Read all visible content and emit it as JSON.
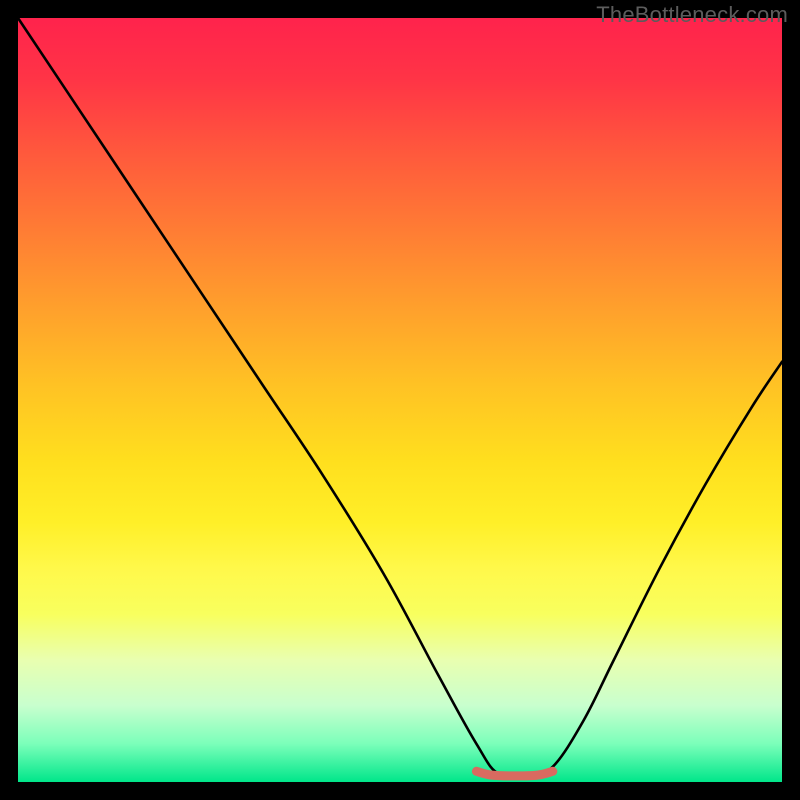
{
  "watermark": "TheBottleneck.com",
  "chart_data": {
    "type": "line",
    "title": "",
    "xlabel": "",
    "ylabel": "",
    "xlim": [
      0,
      100
    ],
    "ylim": [
      0,
      100
    ],
    "background_gradient": {
      "top_color": "#ff234c",
      "bottom_color": "#00e68a",
      "description": "vertical red-to-green heat gradient"
    },
    "series": [
      {
        "name": "bottleneck-curve",
        "color": "#000000",
        "x": [
          0,
          8,
          16,
          24,
          32,
          40,
          48,
          55,
          60,
          63,
          67,
          70,
          74,
          78,
          84,
          90,
          96,
          100
        ],
        "values": [
          100,
          88,
          76,
          64,
          52,
          40,
          27,
          14,
          5,
          1,
          1,
          2,
          8,
          16,
          28,
          39,
          49,
          55
        ]
      },
      {
        "name": "optimal-zone-marker",
        "color": "#d96a60",
        "x": [
          60,
          62,
          65,
          68,
          70
        ],
        "values": [
          1.4,
          0.9,
          0.8,
          0.9,
          1.4
        ]
      }
    ],
    "optimal_range_x": [
      60,
      70
    ]
  }
}
